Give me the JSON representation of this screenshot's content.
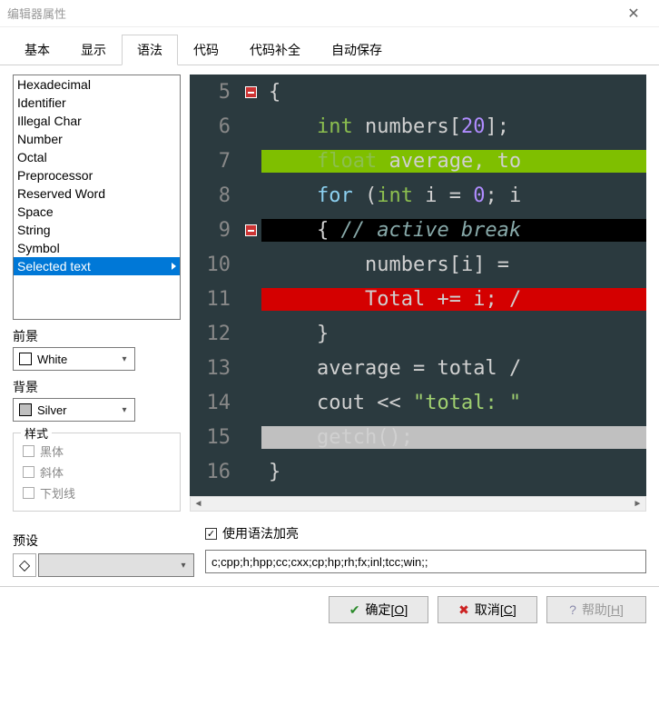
{
  "window": {
    "title": "编辑器属性"
  },
  "tabs": [
    "基本",
    "显示",
    "语法",
    "代码",
    "代码补全",
    "自动保存"
  ],
  "activeTab": 2,
  "syntaxList": [
    "Hexadecimal",
    "Identifier",
    "Illegal Char",
    "Number",
    "Octal",
    "Preprocessor",
    "Reserved Word",
    "Space",
    "String",
    "Symbol",
    "Selected text"
  ],
  "selectedSyntaxIndex": 10,
  "labels": {
    "foreground": "前景",
    "background": "背景",
    "style": "样式",
    "bold": "黑体",
    "italic": "斜体",
    "underline": "下划线",
    "preset": "预设",
    "useHighlight": "使用语法加亮"
  },
  "foreground": {
    "name": "White",
    "color": "#ffffff"
  },
  "background": {
    "name": "Silver",
    "color": "#c0c0c0"
  },
  "extInput": "c;cpp;h;hpp;cc;cxx;cp;hp;rh;fx;inl;tcc;win;;",
  "buttons": {
    "ok": "确定[O]",
    "cancel": "取消[C]",
    "help": "帮助[H]"
  },
  "code": {
    "startLine": 5,
    "lines": [
      {
        "n": 5,
        "fold": true,
        "bg": "",
        "tokens": [
          [
            "punct",
            "{"
          ]
        ]
      },
      {
        "n": 6,
        "fold": false,
        "bg": "",
        "tokens": [
          [
            "ws",
            "    "
          ],
          [
            "typ",
            "int"
          ],
          [
            "ws",
            " "
          ],
          [
            "ident",
            "numbers"
          ],
          [
            "punct",
            "["
          ],
          [
            "num",
            "20"
          ],
          [
            "punct",
            "];"
          ]
        ]
      },
      {
        "n": 7,
        "fold": false,
        "bg": "#7fbf00",
        "tokens": [
          [
            "ws",
            "    "
          ],
          [
            "typ",
            "float"
          ],
          [
            "ws",
            " "
          ],
          [
            "ident",
            "average, to"
          ]
        ]
      },
      {
        "n": 8,
        "fold": false,
        "bg": "",
        "tokens": [
          [
            "ws",
            "    "
          ],
          [
            "kw",
            "for"
          ],
          [
            "ws",
            " "
          ],
          [
            "punct",
            "("
          ],
          [
            "typ",
            "int"
          ],
          [
            "ws",
            " "
          ],
          [
            "ident",
            "i"
          ],
          [
            "ws",
            " "
          ],
          [
            "punct",
            "="
          ],
          [
            "ws",
            " "
          ],
          [
            "num",
            "0"
          ],
          [
            "punct",
            ";"
          ],
          [
            "ws",
            " "
          ],
          [
            "ident",
            "i"
          ]
        ]
      },
      {
        "n": 9,
        "fold": true,
        "bg": "#000000",
        "tokens": [
          [
            "ws",
            "    "
          ],
          [
            "punct",
            "{"
          ],
          [
            "ws",
            " "
          ],
          [
            "com",
            "// active break"
          ]
        ]
      },
      {
        "n": 10,
        "fold": false,
        "bg": "",
        "tokens": [
          [
            "ws",
            "        "
          ],
          [
            "ident",
            "numbers"
          ],
          [
            "punct",
            "["
          ],
          [
            "ident",
            "i"
          ],
          [
            "punct",
            "]"
          ],
          [
            "ws",
            " "
          ],
          [
            "punct",
            "="
          ],
          [
            "ws",
            " "
          ]
        ]
      },
      {
        "n": 11,
        "fold": false,
        "bg": "#d40000",
        "tokens": [
          [
            "ws",
            "        "
          ],
          [
            "ident",
            "Total"
          ],
          [
            "ws",
            " "
          ],
          [
            "punct",
            "+="
          ],
          [
            "ws",
            " "
          ],
          [
            "ident",
            "i"
          ],
          [
            "punct",
            ";"
          ],
          [
            "ws",
            " "
          ],
          [
            "punct",
            "/"
          ]
        ]
      },
      {
        "n": 12,
        "fold": false,
        "bg": "",
        "tokens": [
          [
            "ws",
            "    "
          ],
          [
            "punct",
            "}"
          ]
        ]
      },
      {
        "n": 13,
        "fold": false,
        "bg": "",
        "tokens": [
          [
            "ws",
            "    "
          ],
          [
            "ident",
            "average"
          ],
          [
            "ws",
            " "
          ],
          [
            "punct",
            "="
          ],
          [
            "ws",
            " "
          ],
          [
            "ident",
            "total"
          ],
          [
            "ws",
            " "
          ],
          [
            "punct",
            "/"
          ]
        ]
      },
      {
        "n": 14,
        "fold": false,
        "bg": "",
        "tokens": [
          [
            "ws",
            "    "
          ],
          [
            "ident",
            "cout"
          ],
          [
            "ws",
            " "
          ],
          [
            "punct",
            "<<"
          ],
          [
            "ws",
            " "
          ],
          [
            "str",
            "\"total: \""
          ]
        ]
      },
      {
        "n": 15,
        "fold": false,
        "bg": "#c0c0c0",
        "tokens": [
          [
            "ws",
            "    "
          ],
          [
            "ident",
            "getch"
          ],
          [
            "punct",
            "();"
          ]
        ]
      },
      {
        "n": 16,
        "fold": false,
        "bg": "",
        "tokens": [
          [
            "punct",
            "}"
          ]
        ]
      }
    ]
  }
}
